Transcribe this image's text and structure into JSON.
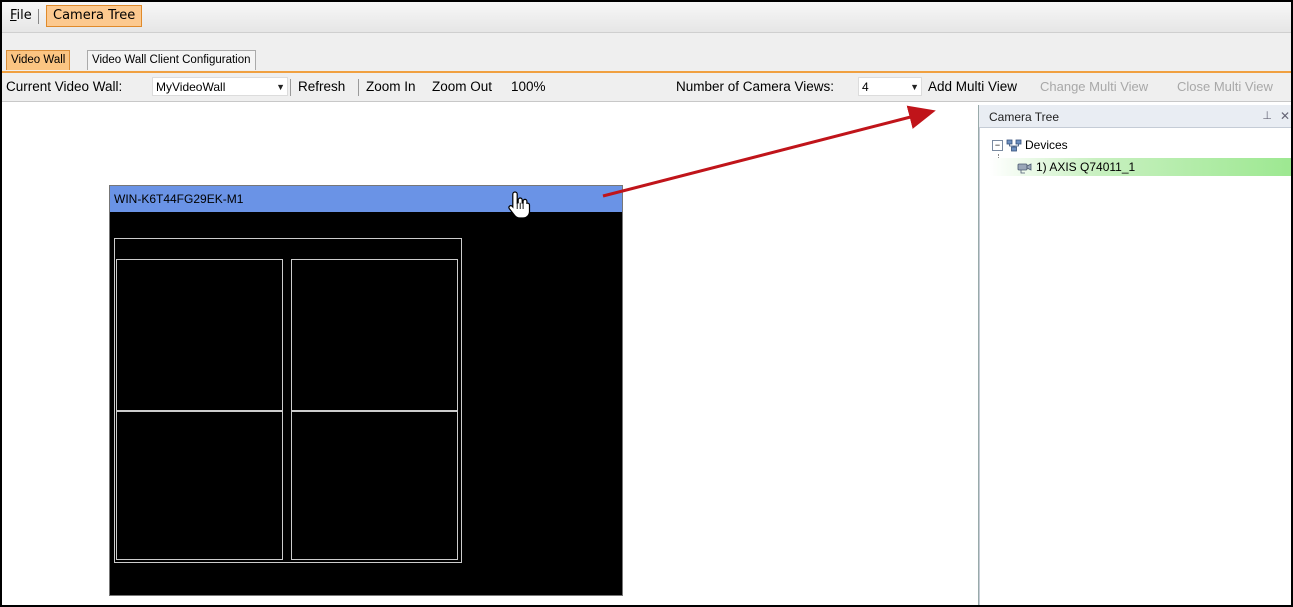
{
  "menu": {
    "file": "File",
    "file_accel": "F",
    "file_rest": "ile",
    "camera_tree": "Camera Tree"
  },
  "tabs": [
    {
      "label": "Video Wall",
      "active": true
    },
    {
      "label": "Video Wall Client Configuration",
      "active": false
    }
  ],
  "toolbar": {
    "current_wall_label": "Current Video Wall:",
    "current_wall_value": "MyVideoWall",
    "refresh": "Refresh",
    "zoom_in": "Zoom In",
    "zoom_out": "Zoom Out",
    "zoom_level": "100%",
    "camera_views_label": "Number of Camera Views:",
    "camera_views_value": "4",
    "add_multi_view": "Add Multi View",
    "change_multi_view": "Change Multi View",
    "close_multi_view": "Close Multi View"
  },
  "monitor": {
    "title": "WIN-K6T44FG29EK-M1",
    "cells": 4
  },
  "panel": {
    "title": "Camera Tree",
    "root": "Devices",
    "camera": "1) AXIS Q74011_1"
  },
  "colors": {
    "accent": "#fbc582",
    "monitor_title": "#6a93e6",
    "selected": "#9ce890",
    "arrow": "#c0141a"
  }
}
